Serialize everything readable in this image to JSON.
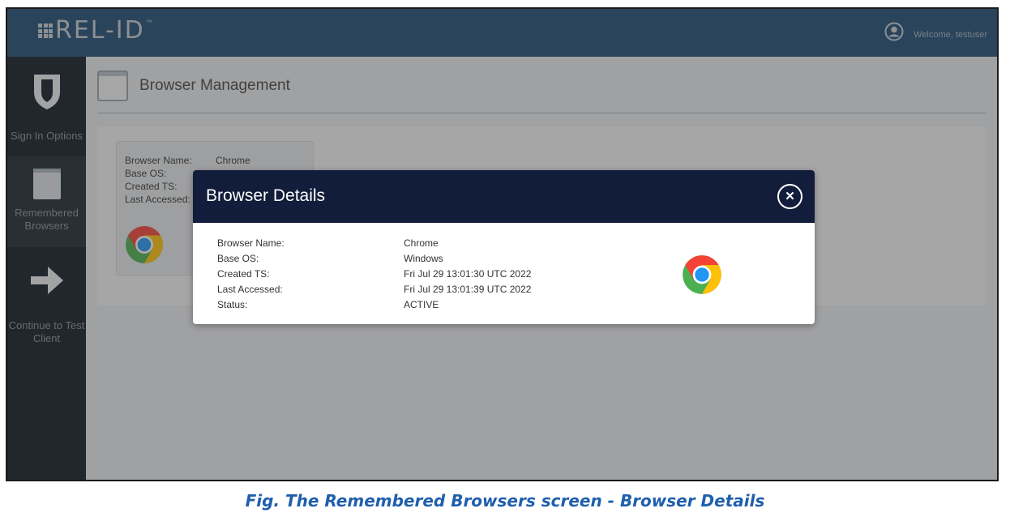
{
  "brand": {
    "logo_text": "REL-ID",
    "tm": "™"
  },
  "header": {
    "welcome": "Welcome, testuser"
  },
  "sidebar": {
    "items": [
      {
        "label": "Sign In Options",
        "icon": "shield-icon"
      },
      {
        "label": "Remembered Browsers",
        "icon": "browser-window-icon"
      },
      {
        "label": "Continue to Test Client",
        "icon": "arrow-right-icon"
      }
    ]
  },
  "page": {
    "title": "Browser Management"
  },
  "card": {
    "rows": [
      {
        "label": "Browser Name:",
        "value": "Chrome"
      },
      {
        "label": "Base OS:",
        "value": ""
      },
      {
        "label": "Created TS:",
        "value": ""
      },
      {
        "label": "Last Accessed:",
        "value": ""
      }
    ],
    "icon": "chrome-icon"
  },
  "modal": {
    "title": "Browser Details",
    "close_glyph": "✕",
    "rows": [
      {
        "label": "Browser Name:",
        "value": "Chrome"
      },
      {
        "label": "Base OS:",
        "value": "Windows"
      },
      {
        "label": "Created TS:",
        "value": "Fri Jul 29 13:01:30 UTC 2022"
      },
      {
        "label": "Last Accessed:",
        "value": "Fri Jul 29 13:01:39 UTC 2022"
      },
      {
        "label": "Status:",
        "value": "ACTIVE"
      }
    ],
    "icon": "chrome-icon"
  },
  "caption": "Fig. The Remembered Browsers screen - Browser Details",
  "colors": {
    "topbar": "#1d4a73",
    "sidebar": "#0f1923",
    "modal_header": "#111d3a",
    "caption": "#1f5fad"
  }
}
